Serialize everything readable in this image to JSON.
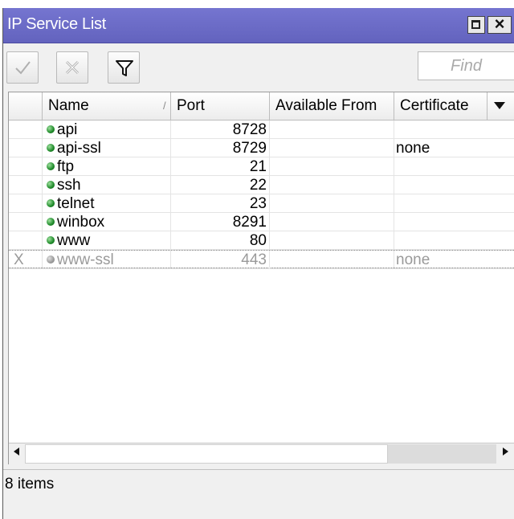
{
  "window": {
    "title": "IP Service List",
    "buttons": {
      "maximize": "maximize-icon",
      "close": "×"
    }
  },
  "toolbar": {
    "enable_icon": "checkmark-icon",
    "disable_icon": "cross-icon",
    "filter_icon": "filter-icon",
    "find_placeholder": "Find"
  },
  "columns": [
    "Name",
    "Port",
    "Available From",
    "Certificate"
  ],
  "rows": [
    {
      "flag": "",
      "name": "api",
      "port": "8728",
      "available_from": "",
      "certificate": "",
      "enabled": true
    },
    {
      "flag": "",
      "name": "api-ssl",
      "port": "8729",
      "available_from": "",
      "certificate": "none",
      "enabled": true
    },
    {
      "flag": "",
      "name": "ftp",
      "port": "21",
      "available_from": "",
      "certificate": "",
      "enabled": true
    },
    {
      "flag": "",
      "name": "ssh",
      "port": "22",
      "available_from": "",
      "certificate": "",
      "enabled": true
    },
    {
      "flag": "",
      "name": "telnet",
      "port": "23",
      "available_from": "",
      "certificate": "",
      "enabled": true
    },
    {
      "flag": "",
      "name": "winbox",
      "port": "8291",
      "available_from": "",
      "certificate": "",
      "enabled": true
    },
    {
      "flag": "",
      "name": "www",
      "port": "80",
      "available_from": "",
      "certificate": "",
      "enabled": true
    },
    {
      "flag": "X",
      "name": "www-ssl",
      "port": "443",
      "available_from": "",
      "certificate": "none",
      "enabled": false
    }
  ],
  "status": {
    "items": "8 items"
  },
  "colors": {
    "titlebar": "#6e6ec8",
    "enabled_dot": "#1f8a2a",
    "disabled_text": "#9a9a9a"
  }
}
